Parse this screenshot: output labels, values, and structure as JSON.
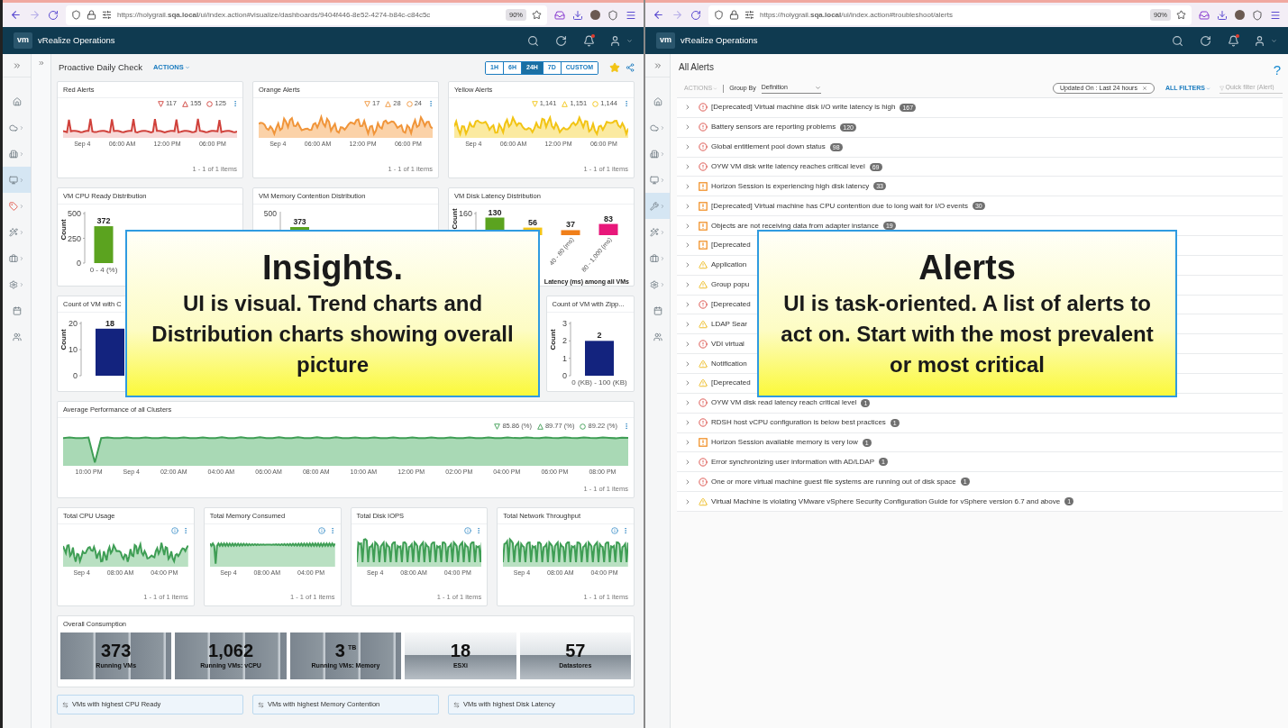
{
  "dashboard_window": {
    "browser": {
      "url": "https://holygrail.**sqa.local**/ui/index.action#visualize/dashboards/9404f446-8e52-4274-b84c-c84c5c",
      "zoom": "90%"
    },
    "app": {
      "logo": "vm",
      "title": "vRealize Operations",
      "notification": true
    },
    "nav": [
      {
        "kind": "home",
        "selected": false,
        "submenu": false
      },
      {
        "kind": "cloud",
        "selected": false,
        "submenu": true
      },
      {
        "kind": "building",
        "selected": false,
        "submenu": true
      },
      {
        "kind": "monitor",
        "selected": true,
        "submenu": true
      },
      {
        "kind": "tag",
        "selected": false,
        "submenu": true
      },
      {
        "kind": "wand",
        "selected": false,
        "submenu": true
      },
      {
        "kind": "briefcase",
        "selected": false,
        "submenu": true
      },
      {
        "kind": "settings",
        "selected": false,
        "submenu": true
      },
      {
        "kind": "calendar",
        "selected": false,
        "submenu": false
      },
      {
        "kind": "users",
        "selected": false,
        "submenu": false
      }
    ],
    "title": "Proactive Daily Check",
    "actions": {
      "label": "ACTIONS",
      "disabled": false
    },
    "ranges": [
      {
        "label": "1H",
        "selected": false
      },
      {
        "label": "6H",
        "selected": false
      },
      {
        "label": "24H",
        "selected": true
      },
      {
        "label": "7D",
        "selected": false
      },
      {
        "label": "CUSTOM",
        "selected": false
      }
    ],
    "favorite": true,
    "alert_charts": [
      {
        "title": "Red Alerts",
        "color": "#d0413b",
        "legend": [
          "117",
          "155",
          "125"
        ],
        "xlabels": [
          "Sep 4",
          "06:00 AM",
          "12:00 PM",
          "06:00 PM"
        ],
        "footer": "1 - 1 of 1 items"
      },
      {
        "title": "Orange Alerts",
        "color": "#f0953a",
        "legend": [
          "17",
          "28",
          "24"
        ],
        "xlabels": [
          "Sep 4",
          "06:00 AM",
          "12:00 PM",
          "06:00 PM"
        ],
        "footer": "1 - 1 of 1 items"
      },
      {
        "title": "Yellow Alerts",
        "color": "#f2c414",
        "legend": [
          "1,141",
          "1,151",
          "1,144"
        ],
        "xlabels": [
          "Sep 4",
          "06:00 AM",
          "12:00 PM",
          "06:00 PM"
        ],
        "footer": "1 - 1 of 1 items"
      }
    ],
    "distribution_charts": [
      {
        "title": "VM CPU Ready Distribution",
        "chart_data": {
          "type": "bar",
          "ylabel": "Count",
          "ylim": [
            0,
            500
          ],
          "yticks": [
            0,
            250,
            500
          ],
          "categories": [
            "0 - 4 (%)"
          ],
          "values": [
            372
          ],
          "colors": [
            "#5ba31f"
          ],
          "data_labels": true
        }
      },
      {
        "title": "VM Memory Contention Distribution",
        "axis_label": "500",
        "bar_label": "373"
      },
      {
        "title": "VM Disk Latency Distribution",
        "chart_data": {
          "type": "bar",
          "ylabel": "Count",
          "xlabel": "Latency (ms) among all VMs",
          "ylim": [
            0,
            160
          ],
          "yticks": [
            160
          ],
          "categories": [
            null,
            null,
            "40 - 80 (ms)",
            "80 - 1,000 (ms)"
          ],
          "values": [
            130,
            56,
            37,
            83
          ],
          "colors": [
            "#5ba31f",
            "#f5c518",
            "#f07f1a",
            "#e8177a"
          ],
          "data_labels": true
        }
      }
    ],
    "count_charts": [
      {
        "title": "Count of VM with C",
        "chart_data": {
          "type": "bar",
          "ylabel": "Count",
          "ylim": [
            0,
            20
          ],
          "yticks": [
            0,
            10,
            20
          ],
          "values": [
            18
          ],
          "colors": [
            "#13237e"
          ],
          "data_labels": true
        }
      },
      {
        "title": "Count of VM with Zipp...",
        "chart_data": {
          "type": "bar",
          "ylabel": "Count",
          "ylim": [
            0,
            3
          ],
          "yticks": [
            0,
            1,
            2,
            3
          ],
          "categories": [
            "0 (KB) - 100 (KB)"
          ],
          "values": [
            2
          ],
          "colors": [
            "#13237e"
          ],
          "data_labels": true
        }
      }
    ],
    "performance": {
      "title": "Average Performance of all Clusters",
      "legend": [
        "85.86 (%)",
        "89.77 (%)",
        "89.22 (%)"
      ],
      "xlabels": [
        "10:00 PM",
        "Sep 4",
        "02:00 AM",
        "04:00 AM",
        "06:00 AM",
        "08:00 AM",
        "10:00 AM",
        "12:00 PM",
        "02:00 PM",
        "04:00 PM",
        "06:00 PM",
        "08:00 PM"
      ],
      "footer": "1 - 1 of 1 items"
    },
    "trend_cards": [
      {
        "title": "Total CPU Usage",
        "xlabels": [
          "Sep 4",
          "08:00 AM",
          "04:00 PM"
        ],
        "footer": "1 - 1 of 1 items"
      },
      {
        "title": "Total Memory Consumed",
        "xlabels": [
          "Sep 4",
          "08:00 AM",
          "04:00 PM"
        ],
        "footer": "1 - 1 of 1 items"
      },
      {
        "title": "Total Disk IOPS",
        "xlabels": [
          "Sep 4",
          "08:00 AM",
          "04:00 PM"
        ],
        "footer": "1 - 1 of 1 items"
      },
      {
        "title": "Total Network Throughput",
        "xlabels": [
          "Sep 4",
          "08:00 AM",
          "04:00 PM"
        ],
        "footer": "1 - 1 of 1 items"
      }
    ],
    "consumption": {
      "title": "Overall Consumption",
      "tiles": [
        {
          "kind": "striped",
          "value": "373",
          "label": "Running VMs"
        },
        {
          "kind": "striped",
          "value": "1,062",
          "label": "Running VMs: vCPU"
        },
        {
          "kind": "striped",
          "value": "3",
          "unit": "TB",
          "label": "Running VMs: Memory"
        },
        {
          "kind": "split",
          "value": "18",
          "label": "ESXi"
        },
        {
          "kind": "split",
          "value": "57",
          "label": "Datastores"
        }
      ]
    },
    "links": [
      "VMs with highest CPU Ready",
      "VMs with highest Memory Contention",
      "VMs with highest Disk Latency"
    ],
    "callout": {
      "heading": "Insights.",
      "text": "UI is visual. Trend charts and Distribution charts showing overall picture"
    }
  },
  "alerts_window": {
    "browser": {
      "url": "https://holygrail.**sqa.local**/ui/index.action#troubleshoot/alerts",
      "zoom": "90%"
    },
    "app": {
      "logo": "vm",
      "title": "vRealize Operations",
      "notification": true
    },
    "nav": [
      {
        "kind": "home",
        "selected": false,
        "submenu": false
      },
      {
        "kind": "cloud",
        "selected": false,
        "submenu": true
      },
      {
        "kind": "building",
        "selected": false,
        "submenu": true
      },
      {
        "kind": "monitor",
        "selected": false,
        "submenu": true
      },
      {
        "kind": "wrench",
        "selected": true,
        "submenu": true
      },
      {
        "kind": "wand",
        "selected": false,
        "submenu": true
      },
      {
        "kind": "briefcase",
        "selected": false,
        "submenu": true
      },
      {
        "kind": "settings",
        "selected": false,
        "submenu": true
      },
      {
        "kind": "calendar",
        "selected": false,
        "submenu": false
      },
      {
        "kind": "users",
        "selected": false,
        "submenu": false
      }
    ],
    "title": "All Alerts",
    "help": "?",
    "actions": {
      "label": "ACTIONS",
      "disabled": true
    },
    "group_by_label": "Group By",
    "group_by": "Definition",
    "filter_chip": "Updated On : Last 24 hours",
    "all_filters": "ALL FILTERS",
    "quick_filter": {
      "placeholder": "Quick filter (Alert)"
    },
    "alerts": [
      {
        "kind": "critical",
        "text": "[Deprecated] Virtual machine disk I/O write latency is high",
        "count": "167",
        "expanded": false
      },
      {
        "kind": "critical",
        "text": "Battery sensors are reporting problems",
        "count": "120",
        "expanded": false
      },
      {
        "kind": "critical",
        "text": "Global entitlement pool down status",
        "count": "98",
        "expanded": false
      },
      {
        "kind": "critical",
        "text": "OYW VM disk write latency reaches critical level",
        "count": "69",
        "expanded": false
      },
      {
        "kind": "immediate",
        "text": "Horizon Session is experiencing high disk latency",
        "count": "33",
        "expanded": false
      },
      {
        "kind": "immediate",
        "text": "[Deprecated] Virtual machine has CPU contention due to long wait for I/O events",
        "count": "30",
        "expanded": false
      },
      {
        "kind": "immediate",
        "text": "Objects are not receiving data from adapter instance",
        "count": "19",
        "expanded": false
      },
      {
        "kind": "immediate",
        "text": "[Deprecated",
        "expanded": false
      },
      {
        "kind": "warning",
        "text": "Application",
        "expanded": false
      },
      {
        "kind": "warning",
        "text": "Group popu",
        "expanded": false
      },
      {
        "kind": "critical",
        "text": "[Deprecated",
        "expanded": false
      },
      {
        "kind": "warning",
        "text": "LDAP Sear",
        "expanded": false
      },
      {
        "kind": "critical",
        "text": "VDI virtual",
        "expanded": false
      },
      {
        "kind": "warning",
        "text": "Notification",
        "expanded": false
      },
      {
        "kind": "warning",
        "text": "[Deprecated",
        "expanded": false
      },
      {
        "kind": "critical",
        "text": "OYW VM disk read latency reach critical level",
        "count": "1",
        "expanded": false
      },
      {
        "kind": "critical",
        "text": "RDSH host vCPU configuration is below best practices",
        "count": "1",
        "expanded": false
      },
      {
        "kind": "immediate",
        "text": "Horizon Session available memory is very low",
        "count": "1",
        "expanded": false
      },
      {
        "kind": "critical",
        "text": "Error synchronizing user information with AD/LDAP",
        "count": "1",
        "expanded": false
      },
      {
        "kind": "critical",
        "text": "One or more virtual machine guest file systems are running out of disk space",
        "count": "1",
        "expanded": false
      },
      {
        "kind": "warning",
        "text": "Virtual Machine is violating VMware vSphere Security Configuration Guide for vSphere version 6.7 and above",
        "count": "1",
        "expanded": false
      }
    ],
    "callout": {
      "heading": "Alerts",
      "text": "UI is task-oriented. A list of alerts to act on. Start with the most prevalent or most critical"
    }
  }
}
